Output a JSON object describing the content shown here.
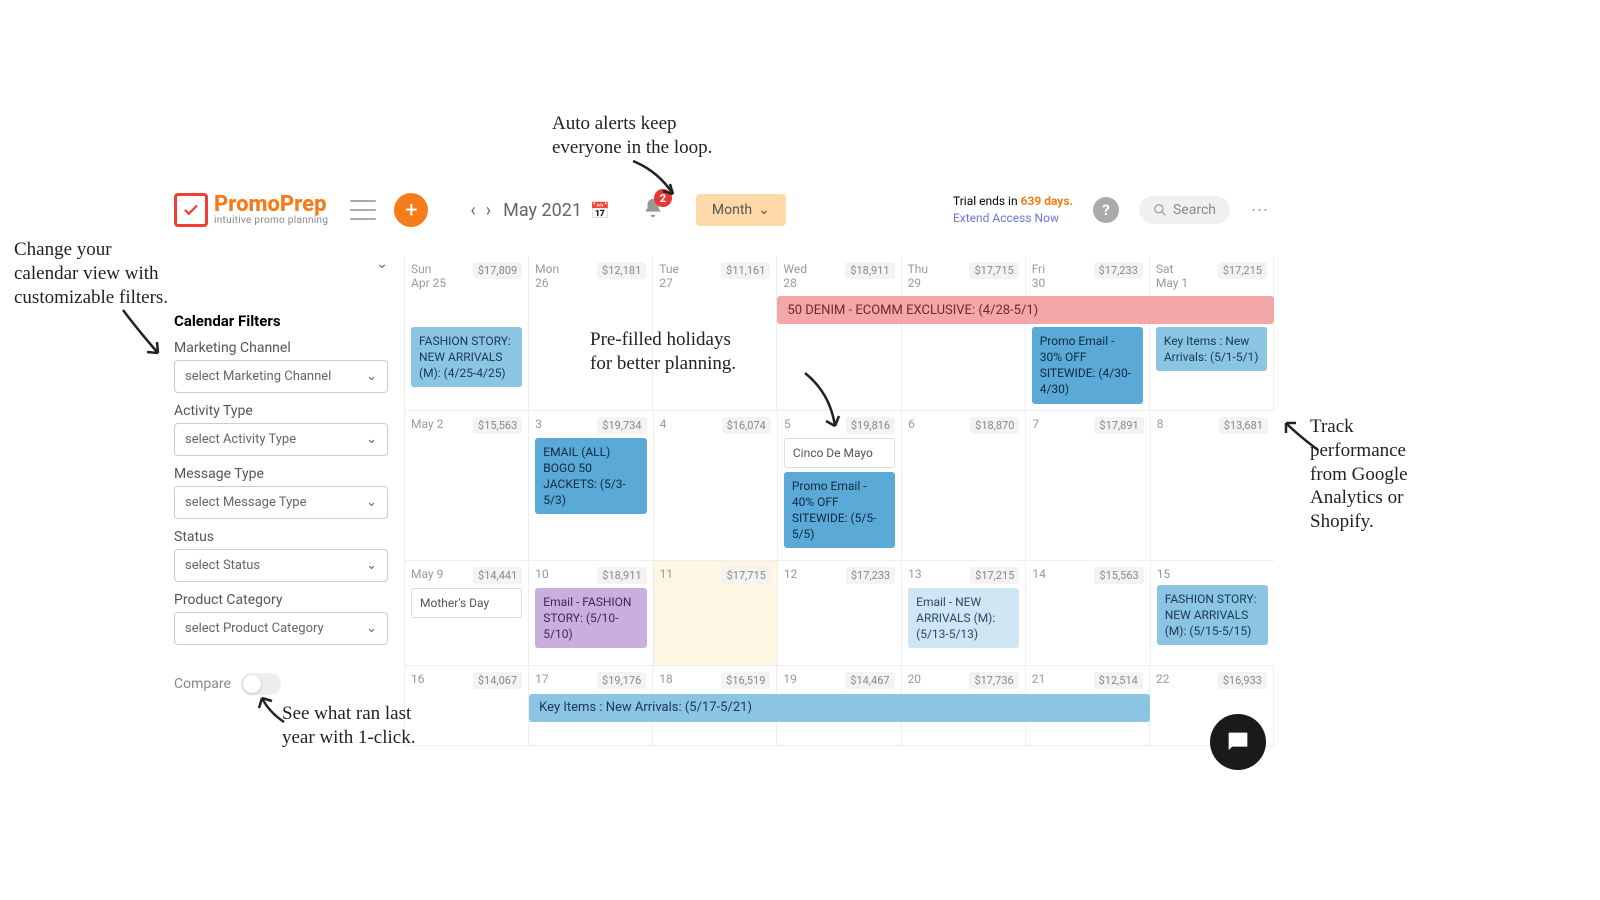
{
  "logo": {
    "name": "PromoPrep",
    "tag": "intuitive promo planning"
  },
  "topbar": {
    "date": "May 2021",
    "viewBtn": "Month",
    "alertCount": "2",
    "searchPlaceholder": "Search"
  },
  "trial": {
    "prefix": "Trial ends in ",
    "days": "639 days.",
    "extend": "Extend Access Now"
  },
  "filters": {
    "collapseIcon": "⌄",
    "title": "Calendar Filters",
    "items": [
      {
        "label": "Marketing Channel",
        "placeholder": "select Marketing Channel"
      },
      {
        "label": "Activity Type",
        "placeholder": "select Activity Type"
      },
      {
        "label": "Message Type",
        "placeholder": "select Message Type"
      },
      {
        "label": "Status",
        "placeholder": "select Status"
      },
      {
        "label": "Product Category",
        "placeholder": "select Product Category"
      }
    ],
    "compare": "Compare"
  },
  "calendar": {
    "weeks": [
      {
        "cells": [
          {
            "dlabel": "Sun\nApr 25",
            "rev": "$17,809",
            "events": [
              {
                "cls": "blue1",
                "t": "FASHION STORY: NEW ARRIVALS (M): (4/25-4/25)"
              }
            ]
          },
          {
            "dlabel": "Mon\n26",
            "rev": "$12,181",
            "events": []
          },
          {
            "dlabel": "Tue\n27",
            "rev": "$11,161",
            "events": []
          },
          {
            "dlabel": "Wed\n28",
            "rev": "$18,911",
            "events": []
          },
          {
            "dlabel": "Thu\n29",
            "rev": "$17,715",
            "events": []
          },
          {
            "dlabel": "Fri\n30",
            "rev": "$17,233",
            "events": [
              {
                "cls": "blue2",
                "t": "Promo Email - 30% OFF SITEWIDE: (4/30-4/30)"
              }
            ]
          },
          {
            "dlabel": "Sat\nMay 1",
            "rev": "$17,215",
            "events": [
              {
                "cls": "blue1",
                "t": "Key Items : New Arrivals: (5/1-5/1)"
              }
            ]
          }
        ],
        "banner": {
          "cls": "pink",
          "t": "50 DENIM - ECOMM EXCLUSIVE: (4/28-5/1)",
          "startCol": 3,
          "span": 4
        }
      },
      {
        "cells": [
          {
            "dlabel": "May 2",
            "rev": "$15,563",
            "events": []
          },
          {
            "dlabel": "3",
            "rev": "$19,734",
            "events": [
              {
                "cls": "blue2",
                "t": "EMAIL (ALL) BOGO 50 JACKETS: (5/3-5/3)"
              }
            ]
          },
          {
            "dlabel": "4",
            "rev": "$16,074",
            "events": []
          },
          {
            "dlabel": "5",
            "rev": "$19,816",
            "events": [
              {
                "cls": "white",
                "t": "Cinco De Mayo"
              },
              {
                "cls": "blue2",
                "t": "Promo Email - 40% OFF SITEWIDE: (5/5-5/5)"
              }
            ]
          },
          {
            "dlabel": "6",
            "rev": "$18,870",
            "events": []
          },
          {
            "dlabel": "7",
            "rev": "$17,891",
            "events": []
          },
          {
            "dlabel": "8",
            "rev": "$13,681",
            "events": []
          }
        ]
      },
      {
        "cells": [
          {
            "dlabel": "May 9",
            "rev": "$14,441",
            "events": [
              {
                "cls": "white",
                "t": "Mother's Day"
              }
            ]
          },
          {
            "dlabel": "10",
            "rev": "$18,911",
            "events": [
              {
                "cls": "purple",
                "t": "Email - FASHION STORY: (5/10-5/10)"
              }
            ]
          },
          {
            "dlabel": "11",
            "rev": "$17,715",
            "events": [],
            "hl": true
          },
          {
            "dlabel": "12",
            "rev": "$17,233",
            "events": []
          },
          {
            "dlabel": "13",
            "rev": "$17,215",
            "events": [
              {
                "cls": "bluepale",
                "t": "Email - NEW ARRIVALS (M): (5/13-5/13)"
              }
            ]
          },
          {
            "dlabel": "14",
            "rev": "$15,563",
            "events": []
          },
          {
            "dlabel": "15",
            "rev": "",
            "events": [
              {
                "cls": "blue1",
                "t": "FASHION STORY: NEW ARRIVALS (M): (5/15-5/15)"
              }
            ]
          }
        ]
      },
      {
        "cells": [
          {
            "dlabel": "16",
            "rev": "$14,067",
            "events": []
          },
          {
            "dlabel": "17",
            "rev": "$19,176",
            "events": []
          },
          {
            "dlabel": "18",
            "rev": "$16,519",
            "events": []
          },
          {
            "dlabel": "19",
            "rev": "$14,467",
            "events": []
          },
          {
            "dlabel": "20",
            "rev": "$17,736",
            "events": []
          },
          {
            "dlabel": "21",
            "rev": "$12,514",
            "events": []
          },
          {
            "dlabel": "22",
            "rev": "$16,933",
            "events": []
          }
        ],
        "banner": {
          "cls": "blue1",
          "t": "Key Items : New Arrivals: (5/17-5/21)",
          "startCol": 1,
          "span": 5
        }
      }
    ]
  },
  "annotations": {
    "alerts": "Auto alerts keep\neveryone in the loop.",
    "filters": "Change your\ncalendar view with\ncustomizable filters.",
    "holidays": "Pre-filled holidays\nfor better planning.",
    "perf": "Track\nperformance\nfrom Google\nAnalytics or\nShopify.",
    "compare": "See what ran last\nyear with 1-click."
  }
}
